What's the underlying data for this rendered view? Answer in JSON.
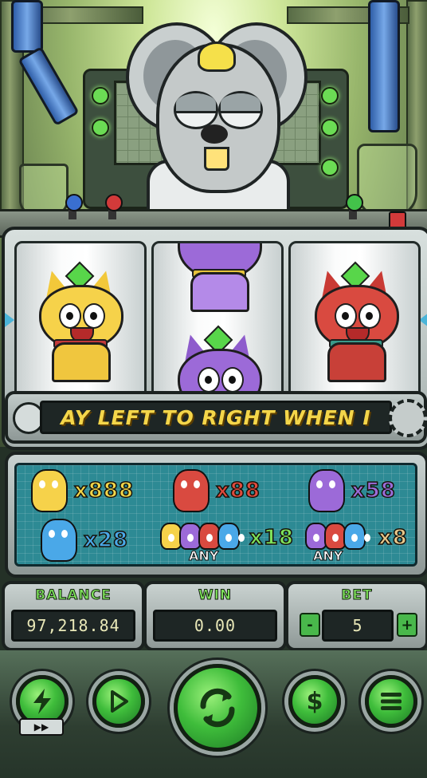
{
  "game": {
    "ticker_text": "AY LEFT TO RIGHT WHEN I",
    "reels": [
      {
        "symbol": "yellow-cat"
      },
      {
        "symbol": "purple-cat"
      },
      {
        "symbol": "red-cat"
      }
    ]
  },
  "paytable": {
    "rows": [
      {
        "symbol": "yellow-cat",
        "multiplier": "x888",
        "color": "#f2d64a"
      },
      {
        "symbol": "red-cat",
        "multiplier": "x88",
        "color": "#e04a3c"
      },
      {
        "symbol": "purple-cat",
        "multiplier": "x58",
        "color": "#9b6cd8"
      },
      {
        "symbol": "blue-cat",
        "multiplier": "x28",
        "color": "#4aa8e8"
      },
      {
        "symbol": "yellow-plus-any",
        "multiplier": "x18",
        "color": "#7ee25a",
        "any_label": "ANY"
      },
      {
        "symbol": "any",
        "multiplier": "x8",
        "color": "#e8c88a",
        "any_label": "ANY"
      }
    ]
  },
  "stats": {
    "balance_label": "BALANCE",
    "balance_value": "97,218.84",
    "win_label": "WIN",
    "win_value": "0.00",
    "bet_label": "BET",
    "bet_value": "5",
    "bet_minus": "-",
    "bet_plus": "+"
  },
  "controls": {
    "turbo_icon": "lightning-icon",
    "autoplay_icon": "play-icon",
    "spin_icon": "spin-arrows-icon",
    "coin_icon": "dollar-icon",
    "menu_icon": "menu-icon"
  },
  "colors": {
    "accent_green": "#3fbd3b",
    "ticker_yellow": "#f4d64a",
    "label_green": "#7ee25a"
  }
}
